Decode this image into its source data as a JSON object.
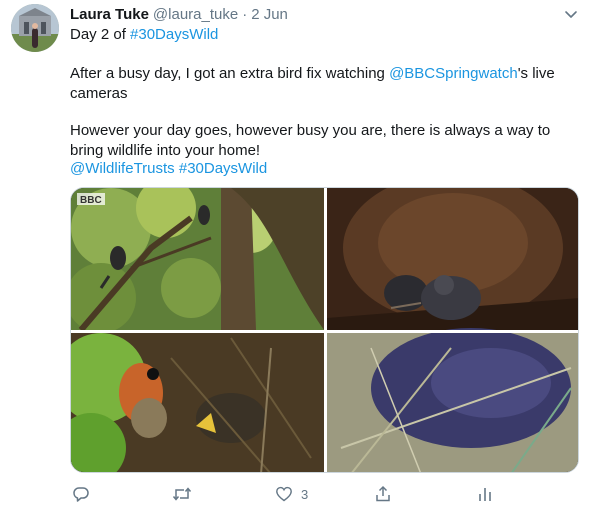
{
  "tweet": {
    "display_name": "Laura Tuke",
    "handle": "@laura_tuke",
    "separator": "·",
    "date": "2 Jun",
    "line1_prefix": "Day 2 of ",
    "line1_hashtag": "#30DaysWild",
    "para1_prefix": "After a busy day, I got an extra bird fix watching ",
    "para1_mention": "@BBCSpringwatch",
    "para1_suffix": "'s live",
    "para1_line2": "cameras",
    "para2_line1": "However your day goes, however busy you are, there is always a way to",
    "para2_line2": "bring wildlife into your home!",
    "mention2": "@WildlifeTrusts",
    "hashtag2": "#30DaysWild"
  },
  "media": {
    "logo_text": "BBC"
  },
  "actions": {
    "like_count": "3"
  },
  "colors": {
    "link": "#1b95e0",
    "secondary_text": "#657786",
    "primary_text": "#14171a"
  }
}
